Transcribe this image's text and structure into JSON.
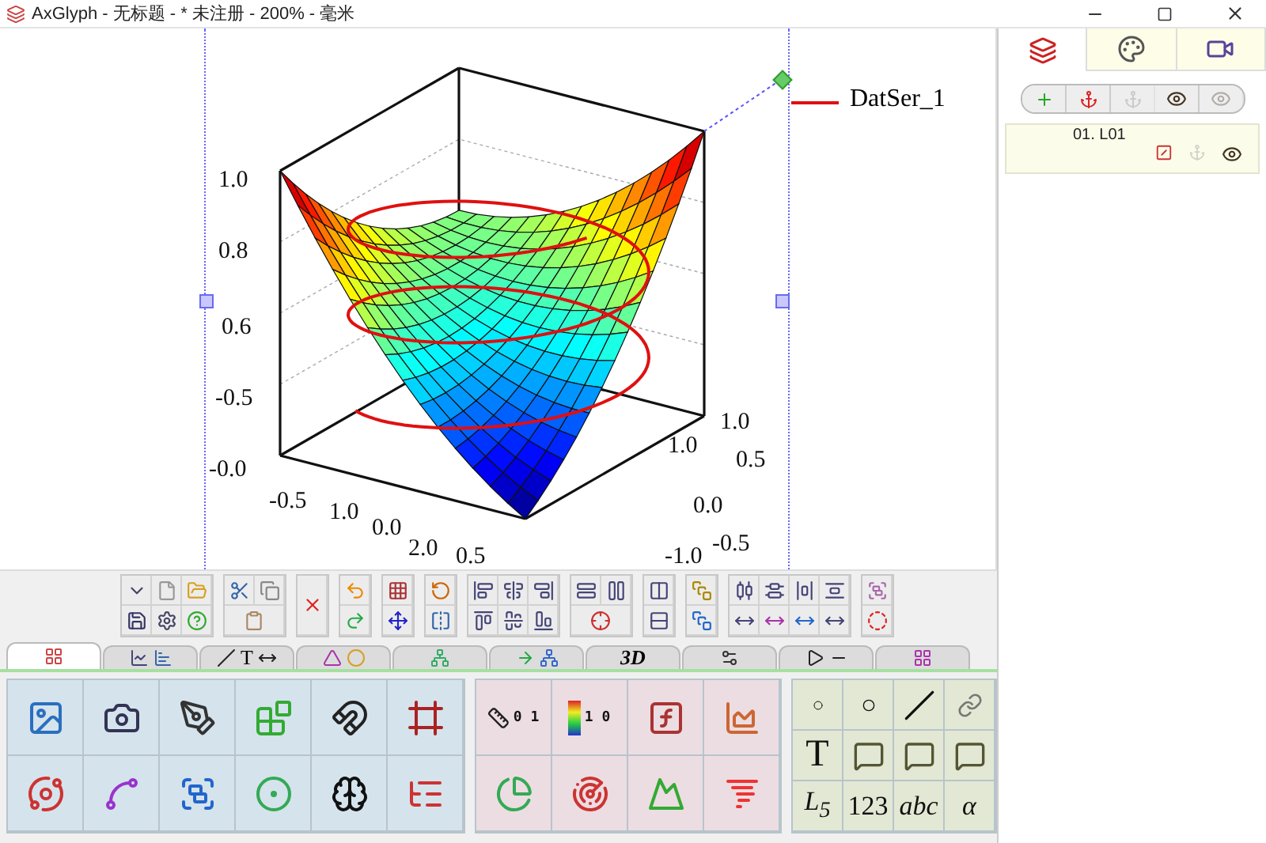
{
  "window": {
    "title": "AxGlyph - 无标题 - * 未注册 - 200% - 毫米"
  },
  "plot": {
    "legend": "DatSer_1",
    "z_ticks": [
      "1.0",
      "0.8",
      "0.6",
      "-0.5",
      "-0.0"
    ],
    "x_ticks": [
      "-0.5",
      "1.0",
      "0.0",
      "2.0",
      "0.5"
    ],
    "y_ticks": [
      "1.0",
      "1.0",
      "0.5",
      "0.0",
      "-0.5",
      "-1.0"
    ]
  },
  "tabs": [
    {
      "selected": true
    },
    {
      "selected": false
    },
    {
      "label": "T",
      "selected": false
    },
    {
      "selected": false
    },
    {
      "selected": false
    },
    {
      "selected": false
    },
    {
      "label": "3D",
      "selected": false
    },
    {
      "selected": false
    },
    {
      "selected": false
    },
    {
      "selected": false
    }
  ],
  "chart_palette": {
    "ruler_text": "0 1",
    "colorbar_text": "1 0"
  },
  "text_cells": [
    "T",
    "L$_{5}$",
    "123",
    "abc",
    "α"
  ],
  "side_tabs": [
    {
      "selected": true
    },
    {
      "selected": false
    },
    {
      "selected": false
    }
  ],
  "layer_buttons": [
    {
      "disabled": false
    },
    {
      "disabled": false
    },
    {
      "disabled": true
    },
    {
      "disabled": false
    },
    {
      "disabled": true
    }
  ],
  "layer": {
    "name": "01. L01",
    "anchor_disabled": true
  }
}
